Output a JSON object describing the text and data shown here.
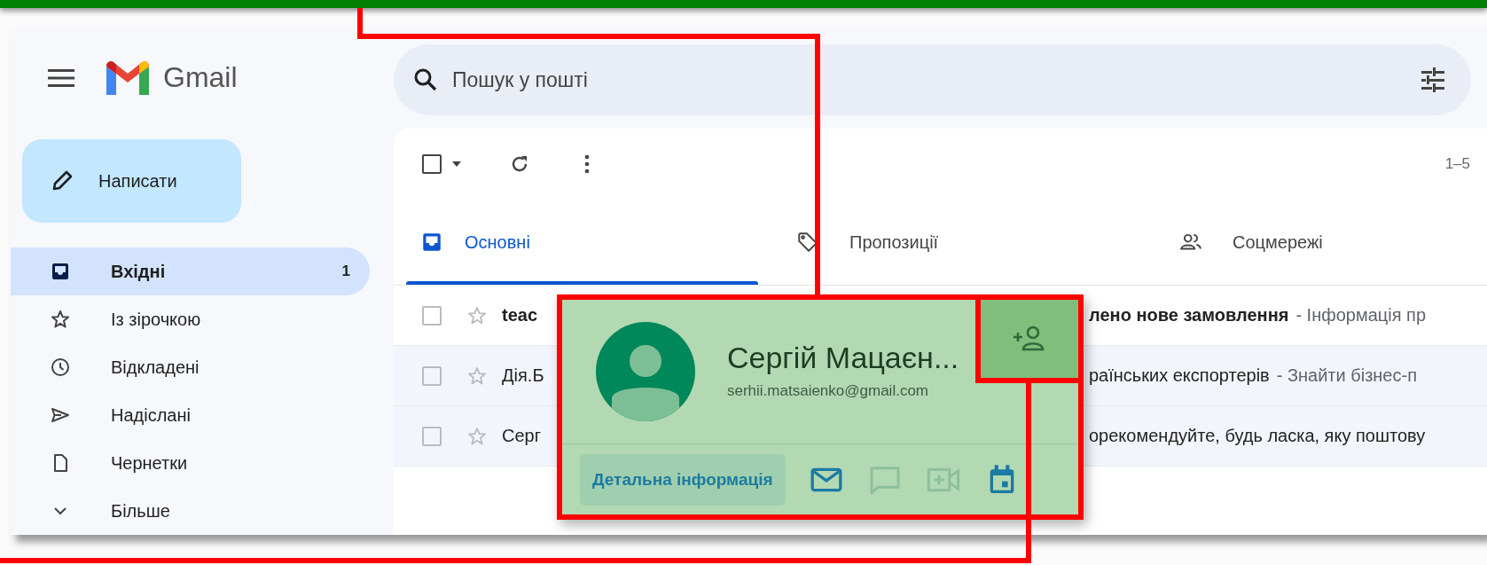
{
  "app": {
    "logo_text": "Gmail"
  },
  "search": {
    "placeholder": "Пошук у пошті"
  },
  "compose": {
    "label": "Написати"
  },
  "sidebar": {
    "items": [
      {
        "kind": "inbox",
        "label": "Вхідні",
        "count": "1",
        "selected": true
      },
      {
        "kind": "starred",
        "label": "Із зірочкою",
        "selected": false
      },
      {
        "kind": "snoozed",
        "label": "Відкладені",
        "selected": false
      },
      {
        "kind": "sent",
        "label": "Надіслані",
        "selected": false
      },
      {
        "kind": "drafts",
        "label": "Чернетки",
        "selected": false
      },
      {
        "kind": "more",
        "label": "Більше",
        "selected": false
      }
    ]
  },
  "toolbar": {
    "select_all_checked": false,
    "page_range": "1–5"
  },
  "tabs": [
    {
      "kind": "primary",
      "label": "Основні",
      "selected": true
    },
    {
      "kind": "promotions",
      "label": "Пропозиції",
      "selected": false
    },
    {
      "kind": "social",
      "label": "Соцмережі",
      "selected": false
    }
  ],
  "emails": [
    {
      "sender": "teac",
      "subject": "лено нове замовлення",
      "snippet": "- Інформація пр",
      "unread": true
    },
    {
      "sender": "Дія.Б",
      "subject": "раїнських експортерів",
      "snippet": "- Знайти бізнес-п",
      "unread": false
    },
    {
      "sender": "Серг",
      "subject": "орекомендуйте, будь ласка, яку поштову",
      "unread": false
    }
  ],
  "contact_card": {
    "name": "Сергій Мацаєн...",
    "email": "serhii.matsaienko@gmail.com",
    "details_button": "Детальна інформація",
    "actions": [
      {
        "kind": "mail",
        "disabled": false
      },
      {
        "kind": "chat",
        "disabled": true
      },
      {
        "kind": "video",
        "disabled": true
      },
      {
        "kind": "calendar",
        "disabled": false
      }
    ]
  }
}
